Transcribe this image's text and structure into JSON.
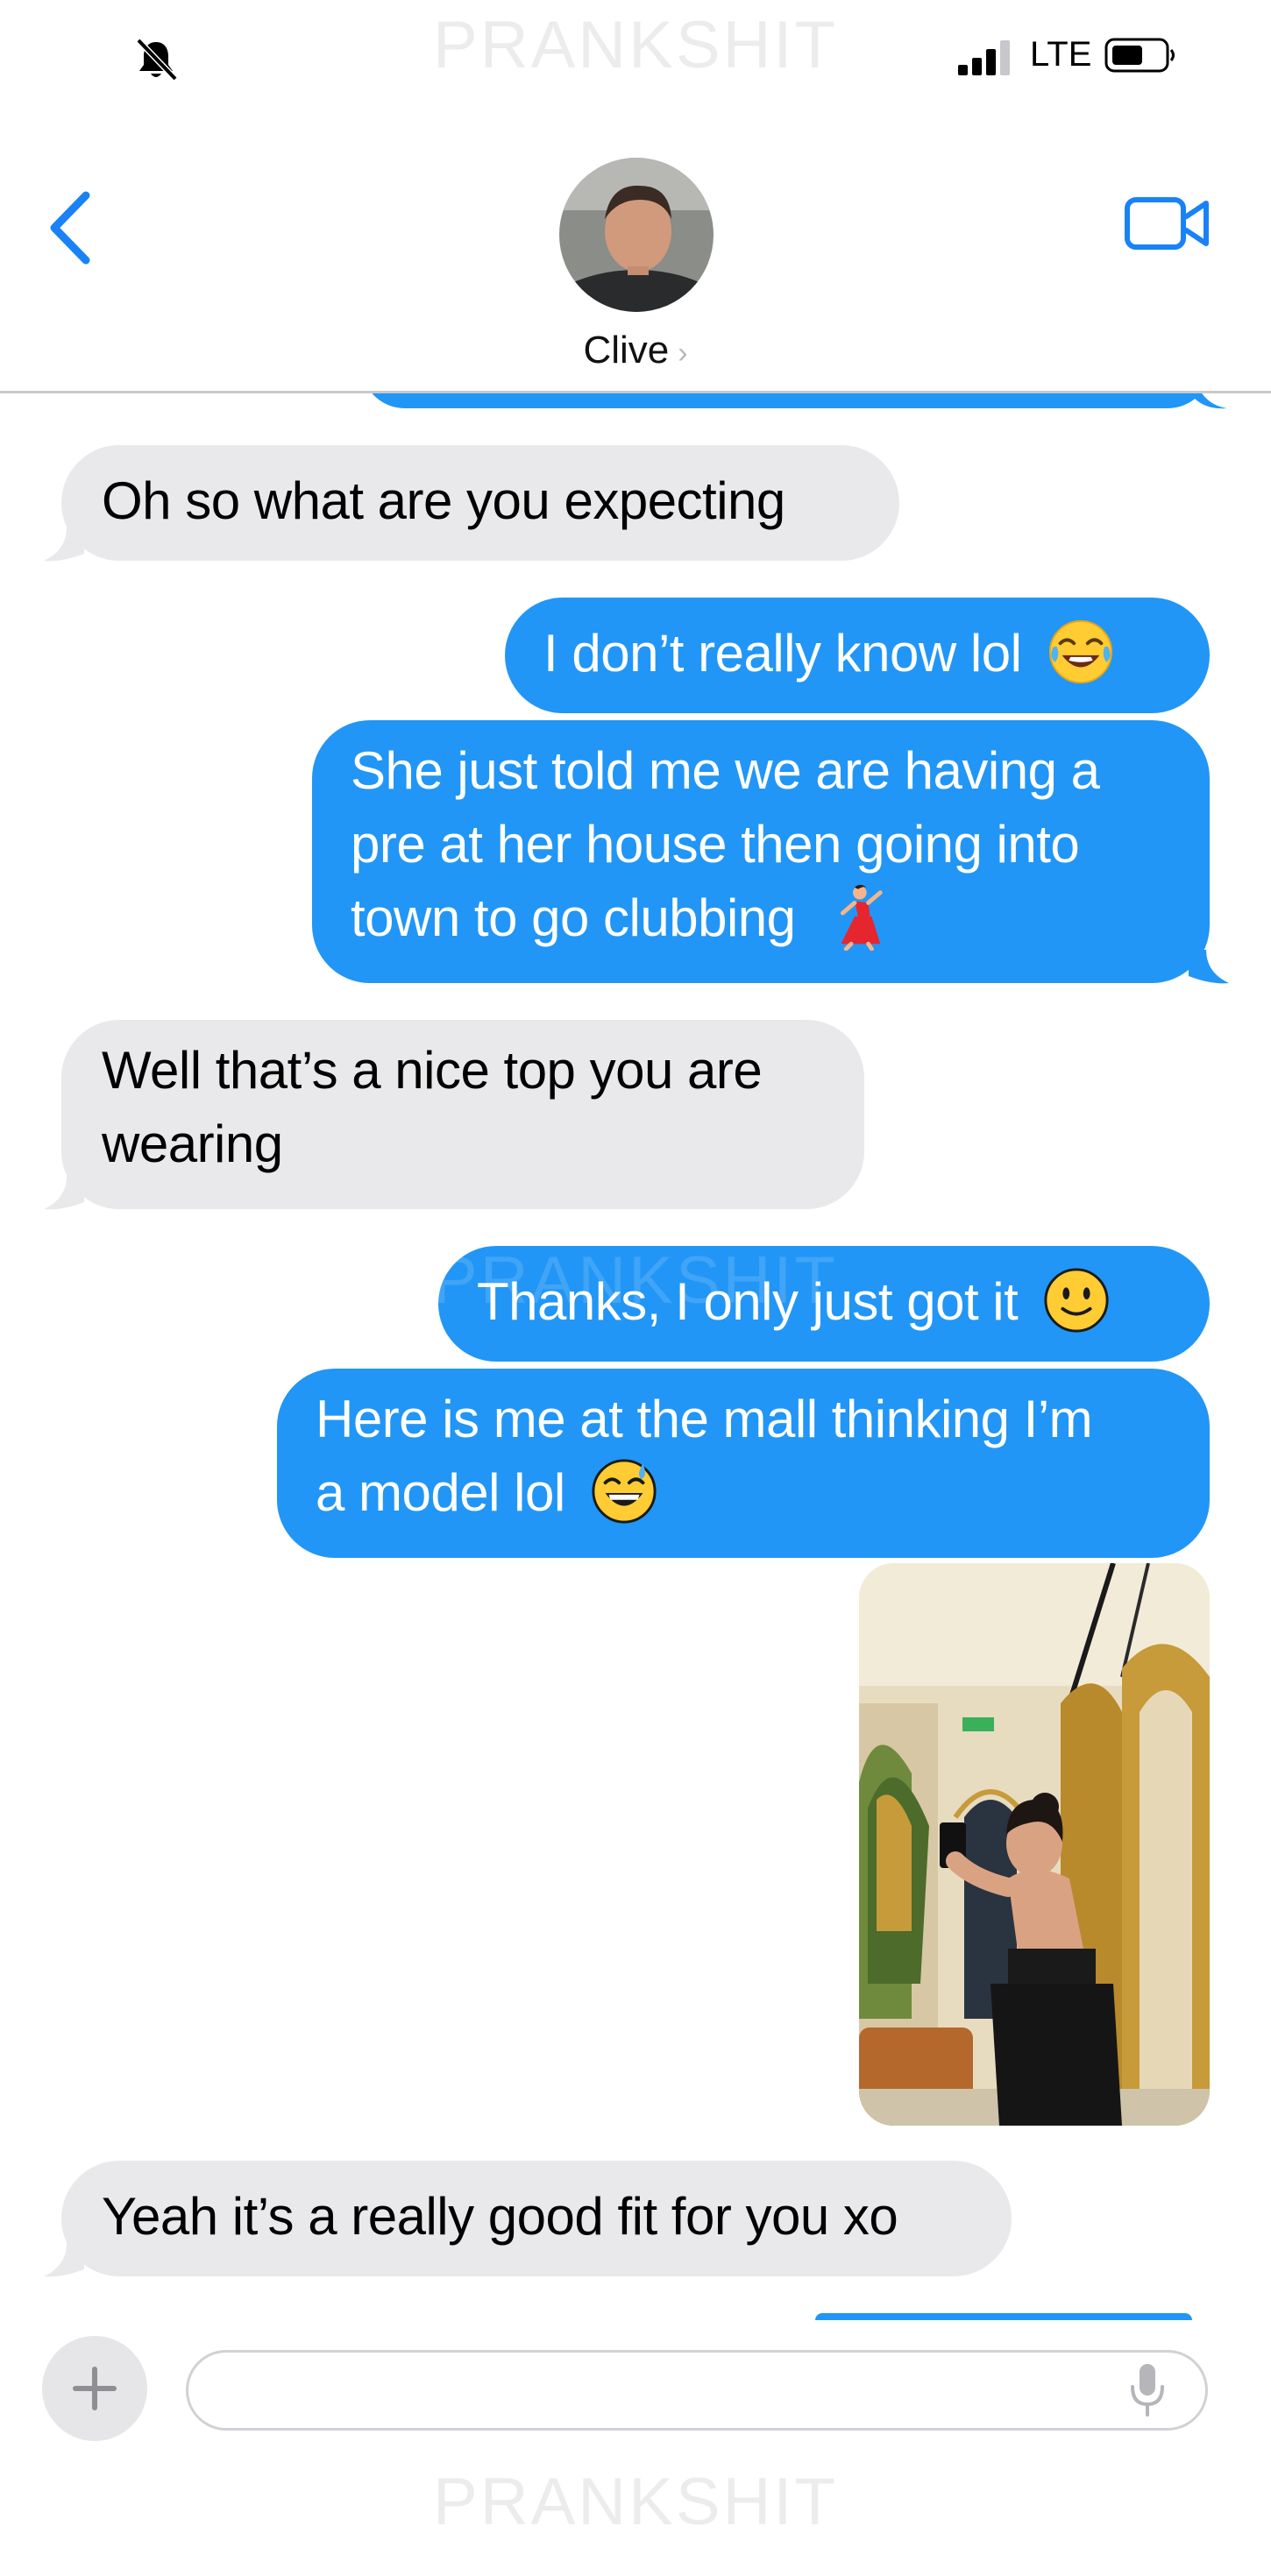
{
  "watermark": {
    "text": "PRANKSHIT"
  },
  "status_bar": {
    "network": "LTE"
  },
  "header": {
    "contact_name": "Clive",
    "chevron": "›"
  },
  "messages": [
    {
      "from": "contact",
      "text": "Oh so what are you expecting"
    },
    {
      "from": "me",
      "text": "I don’t really know lol",
      "emoji": "face-with-tears-of-joy"
    },
    {
      "from": "me",
      "lines": [
        "She just told me we are having a",
        "pre at her house then going into",
        "town to go clubbing"
      ],
      "emoji": "dancing-woman"
    },
    {
      "from": "contact",
      "lines": [
        "Well that’s a nice top you are",
        "wearing"
      ]
    },
    {
      "from": "me",
      "text": "Thanks, I only just got it",
      "emoji": "slightly-smiling-face"
    },
    {
      "from": "me",
      "lines": [
        "Here is me at the mall thinking I’m",
        "a model lol"
      ],
      "emoji": "grinning-face-with-sweat"
    },
    {
      "from": "me",
      "type": "photo",
      "subject": "mirror selfie in mall hallway with gold arches"
    },
    {
      "from": "contact",
      "text": "Yeah it’s a really good fit for you xo"
    }
  ],
  "composer": {
    "value": "",
    "placeholder": ""
  },
  "colors": {
    "outgoing": "#2196f6",
    "incoming": "#e9e9eb",
    "accent": "#1a82f7"
  },
  "icons": [
    "mute-bell-icon",
    "signal-icon",
    "battery-icon",
    "back-chevron-icon",
    "video-camera-icon",
    "plus-icon",
    "microphone-icon"
  ]
}
